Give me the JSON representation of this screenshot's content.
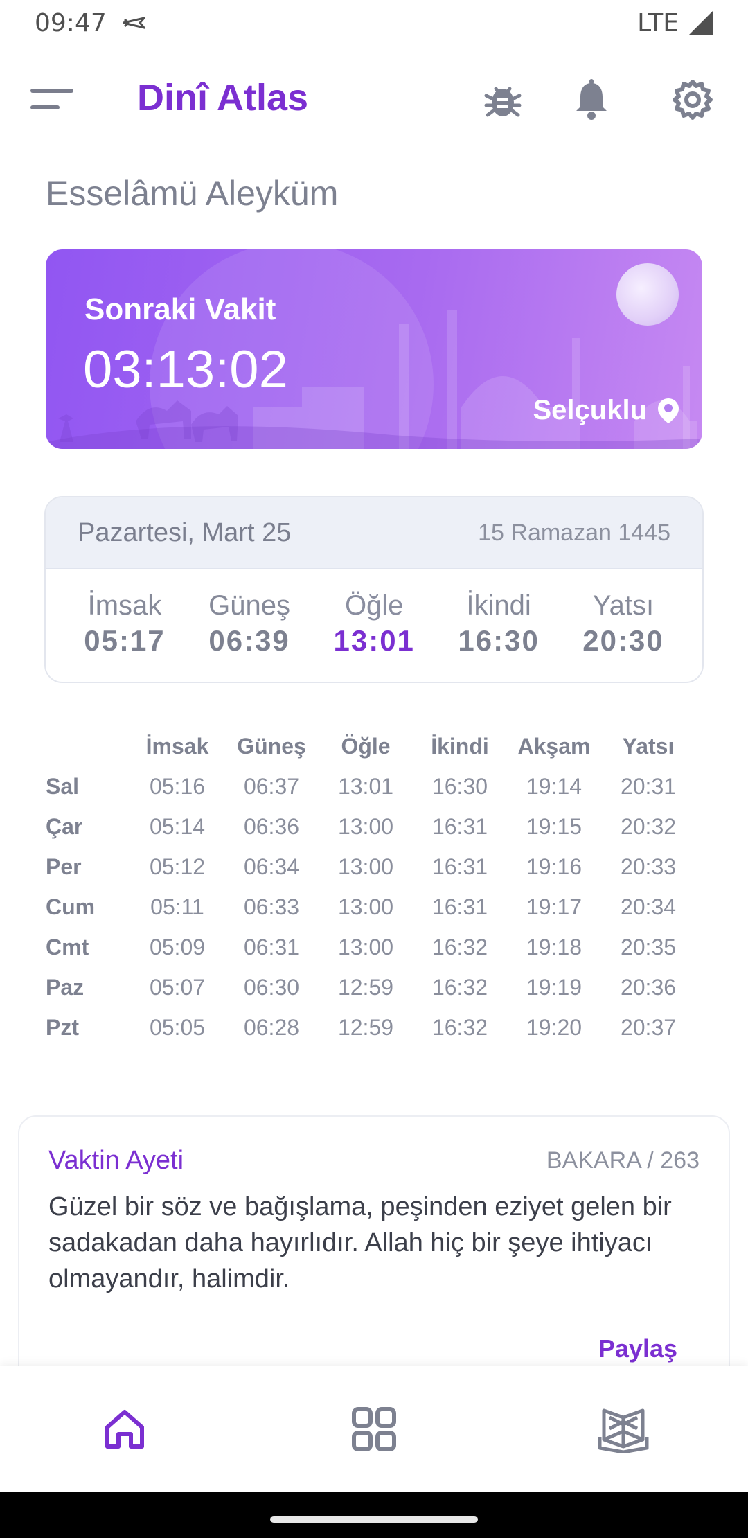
{
  "status_bar": {
    "time": "09:47",
    "network": "LTE"
  },
  "app": {
    "title": "Dinî Atlas"
  },
  "greeting": "Esselâmü Aleyküm",
  "next_prayer": {
    "label": "Sonraki Vakit",
    "countdown": "03:13:02",
    "location": "Selçuklu"
  },
  "today": {
    "date": "Pazartesi, Mart 25",
    "hijri": "15 Ramazan 1445",
    "times": [
      {
        "name": "İmsak",
        "time": "05:17"
      },
      {
        "name": "Güneş",
        "time": "06:39"
      },
      {
        "name": "Öğle",
        "time": "13:01",
        "active": true
      },
      {
        "name": "İkindi",
        "time": "16:30"
      },
      {
        "name": "Yatsı",
        "time": "20:30"
      }
    ]
  },
  "week": {
    "headers": [
      "İmsak",
      "Güneş",
      "Öğle",
      "İkindi",
      "Akşam",
      "Yatsı"
    ],
    "rows": [
      {
        "day": "Sal",
        "times": [
          "05:16",
          "06:37",
          "13:01",
          "16:30",
          "19:14",
          "20:31"
        ]
      },
      {
        "day": "Çar",
        "times": [
          "05:14",
          "06:36",
          "13:00",
          "16:31",
          "19:15",
          "20:32"
        ]
      },
      {
        "day": "Per",
        "times": [
          "05:12",
          "06:34",
          "13:00",
          "16:31",
          "19:16",
          "20:33"
        ]
      },
      {
        "day": "Cum",
        "times": [
          "05:11",
          "06:33",
          "13:00",
          "16:31",
          "19:17",
          "20:34"
        ]
      },
      {
        "day": "Cmt",
        "times": [
          "05:09",
          "06:31",
          "13:00",
          "16:32",
          "19:18",
          "20:35"
        ]
      },
      {
        "day": "Paz",
        "times": [
          "05:07",
          "06:30",
          "12:59",
          "16:32",
          "19:19",
          "20:36"
        ]
      },
      {
        "day": "Pzt",
        "times": [
          "05:05",
          "06:28",
          "12:59",
          "16:32",
          "19:20",
          "20:37"
        ]
      }
    ]
  },
  "verse": {
    "title": "Vaktin Ayeti",
    "reference": "BAKARA / 263",
    "text": "Güzel bir söz ve bağışlama, peşinden eziyet gelen bir sadakadan daha hayırlıdır. Allah hiç bir şeye ihtiyacı olmayandır, halimdir.",
    "share_label": "Paylaş"
  },
  "icons": {
    "menu": "menu-icon",
    "bug": "bug-icon",
    "bell": "bell-icon",
    "settings": "gear-icon",
    "location": "location-pin-icon",
    "home": "home-icon",
    "grid": "grid-icon",
    "book": "book-icon"
  },
  "colors": {
    "accent": "#7b2fd1",
    "card_start": "#9156f2",
    "card_end": "#c689f2"
  }
}
